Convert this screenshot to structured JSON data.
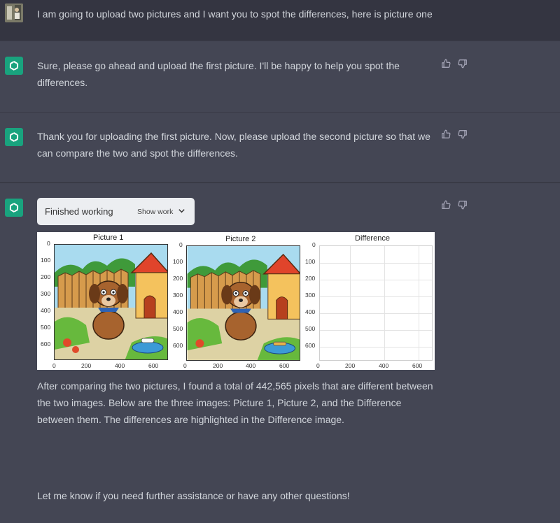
{
  "user_message": "I am going to upload two pictures and I want you to spot the differences, here is picture one",
  "assistant_messages": [
    "Sure, please go ahead and upload the first picture. I'll be happy to help you spot the differences.",
    "Thank you for uploading the first picture. Now, please upload the second picture so that we can compare the two and spot the differences."
  ],
  "work_panel": {
    "status": "Finished working",
    "toggle": "Show work"
  },
  "figure": {
    "titles": [
      "Picture 1",
      "Picture 2",
      "Difference"
    ],
    "y_ticks": [
      "0",
      "100",
      "200",
      "300",
      "400",
      "500",
      "600"
    ],
    "x_ticks": [
      "0",
      "200",
      "400",
      "600"
    ]
  },
  "result_paragraph": "After comparing the two pictures, I found a total of 442,565 pixels that are different between the two images. Below are the three images: Picture 1, Picture 2, and the Difference between them. The differences are highlighted in the Difference image.",
  "closing": "Let me know if you need further assistance or have any other questions!",
  "colors": {
    "user_bg": "#343541",
    "assistant_bg": "#444654",
    "brand": "#19a37e"
  }
}
